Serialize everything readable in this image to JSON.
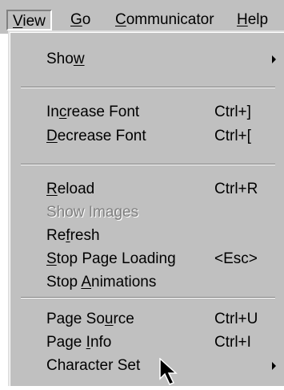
{
  "menubar": {
    "view_pre": "",
    "view_key": "V",
    "view_post": "iew",
    "go_pre": "",
    "go_key": "G",
    "go_post": "o",
    "communicator_pre": "",
    "communicator_key": "C",
    "communicator_post": "ommunicator",
    "help_pre": "",
    "help_key": "H",
    "help_post": "elp"
  },
  "view_menu": {
    "show": {
      "pre": "Sho",
      "key": "w",
      "post": ""
    },
    "increase_font": {
      "pre": "In",
      "key": "c",
      "post": "rease Font",
      "shortcut": "Ctrl+]"
    },
    "decrease_font": {
      "pre": "",
      "key": "D",
      "post": "ecrease Font",
      "shortcut": "Ctrl+["
    },
    "reload": {
      "pre": "",
      "key": "R",
      "post": "eload",
      "shortcut": "Ctrl+R"
    },
    "show_images": {
      "label": "Show Images"
    },
    "refresh": {
      "pre": "Re",
      "key": "f",
      "post": "resh"
    },
    "stop_page_loading": {
      "pre": "",
      "key": "S",
      "post": "top Page Loading",
      "shortcut": "<Esc>"
    },
    "stop_animations": {
      "pre": "Stop ",
      "key": "A",
      "post": "nimations"
    },
    "page_source": {
      "pre": "Page So",
      "key": "u",
      "post": "rce",
      "shortcut": "Ctrl+U"
    },
    "page_info": {
      "pre": "Page ",
      "key": "I",
      "post": "nfo",
      "shortcut": "Ctrl+I"
    },
    "character_set": {
      "pre": "Character Set",
      "key": "",
      "post": ""
    }
  },
  "icons": {
    "submenu_arrow": "submenu-arrow-icon",
    "cursor": "mouse-pointer-icon"
  },
  "colors": {
    "menu_face": "#c0c0c0",
    "text": "#000000",
    "disabled_text": "#808080",
    "highlight": "#ffffff",
    "shadow": "#808080"
  }
}
